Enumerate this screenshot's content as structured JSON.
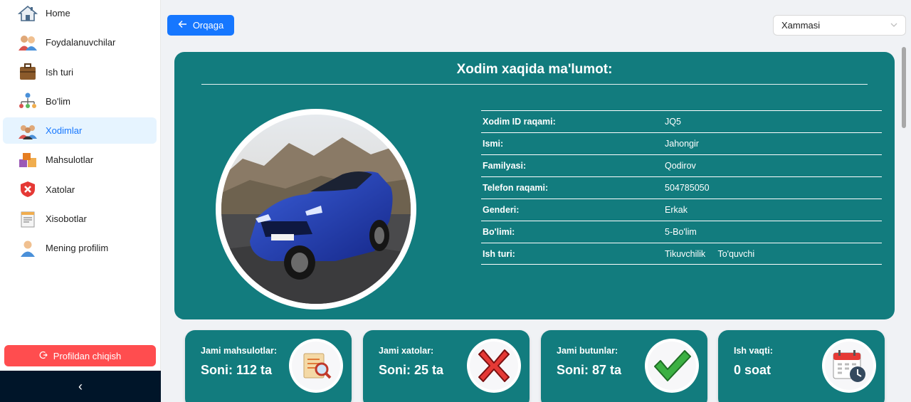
{
  "sidebar": {
    "items": [
      {
        "label": "Home",
        "icon": "home-icon"
      },
      {
        "label": "Foydalanuvchilar",
        "icon": "users-icon"
      },
      {
        "label": "Ish turi",
        "icon": "briefcase-icon"
      },
      {
        "label": "Bo'lim",
        "icon": "org-chart-icon"
      },
      {
        "label": "Xodimlar",
        "icon": "employees-icon",
        "active": true
      },
      {
        "label": "Mahsulotlar",
        "icon": "products-icon"
      },
      {
        "label": "Xatolar",
        "icon": "error-shield-icon"
      },
      {
        "label": "Xisobotlar",
        "icon": "report-icon"
      },
      {
        "label": "Mening profilim",
        "icon": "profile-icon"
      }
    ],
    "logout_label": "Profildan chiqish",
    "collapse_glyph": "‹"
  },
  "toolbar": {
    "back_label": "Orqaga",
    "filter_value": "Xammasi"
  },
  "info": {
    "title": "Xodim xaqida ma'lumot:",
    "rows": [
      {
        "label": "Xodim ID raqami:",
        "value": "JQ5"
      },
      {
        "label": "Ismi:",
        "value": "Jahongir"
      },
      {
        "label": "Familyasi:",
        "value": "Qodirov"
      },
      {
        "label": "Telefon raqami:",
        "value": "504785050"
      },
      {
        "label": "Genderi:",
        "value": "Erkak"
      },
      {
        "label": "Bo'limi:",
        "value": "5-Bo'lim"
      },
      {
        "label": "Ish turi:",
        "tags": [
          "Tikuvchilik",
          "To'quvchi"
        ]
      }
    ]
  },
  "stats": [
    {
      "label": "Jami mahsulotlar:",
      "value": "Soni: 112 ta",
      "icon": "magnifier-document-icon"
    },
    {
      "label": "Jami xatolar:",
      "value": "Soni: 25 ta",
      "icon": "red-x-icon"
    },
    {
      "label": "Jami butunlar:",
      "value": "Soni: 87 ta",
      "icon": "green-check-icon"
    },
    {
      "label": "Ish vaqti:",
      "value": "0 soat",
      "icon": "calendar-clock-icon"
    }
  ],
  "colors": {
    "primary": "#1677ff",
    "teal": "#127c7e",
    "danger": "#ff4d4f",
    "sidebar_footer": "#001529",
    "active_bg": "#e6f4ff"
  }
}
